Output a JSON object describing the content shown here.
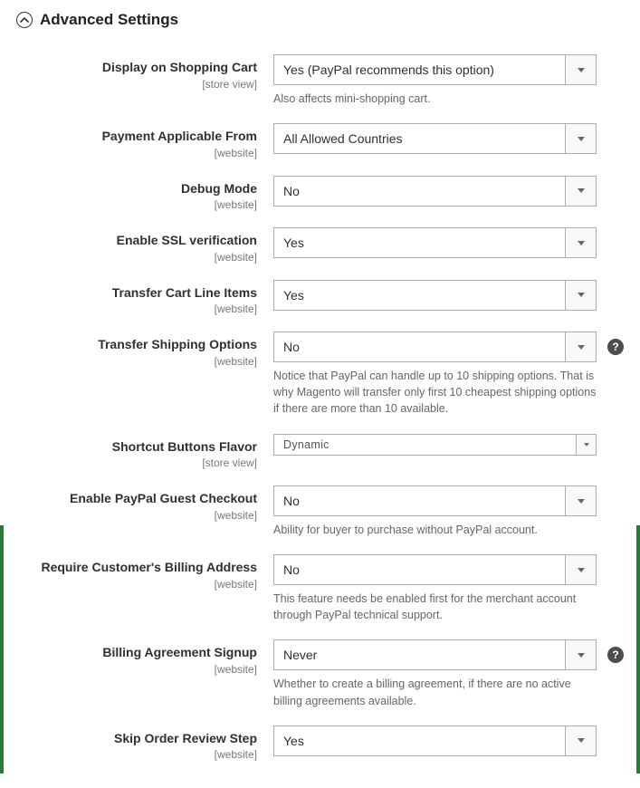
{
  "section": {
    "title": "Advanced Settings"
  },
  "scopes": {
    "store_view": "[store view]",
    "website": "[website]"
  },
  "help_glyph": "?",
  "fields": {
    "display_on_cart": {
      "label": "Display on Shopping Cart",
      "scope": "store_view",
      "value": "Yes (PayPal recommends this option)",
      "note": "Also affects mini-shopping cart."
    },
    "payment_applicable_from": {
      "label": "Payment Applicable From",
      "scope": "website",
      "value": "All Allowed Countries"
    },
    "debug_mode": {
      "label": "Debug Mode",
      "scope": "website",
      "value": "No"
    },
    "enable_ssl": {
      "label": "Enable SSL verification",
      "scope": "website",
      "value": "Yes"
    },
    "transfer_cart_line_items": {
      "label": "Transfer Cart Line Items",
      "scope": "website",
      "value": "Yes"
    },
    "transfer_shipping_options": {
      "label": "Transfer Shipping Options",
      "scope": "website",
      "value": "No",
      "note": "Notice that PayPal can handle up to 10 shipping options. That is why Magento will transfer only first 10 cheapest shipping options if there are more than 10 available.",
      "help": true
    },
    "shortcut_buttons_flavor": {
      "label": "Shortcut Buttons Flavor",
      "scope": "store_view",
      "value": "Dynamic"
    },
    "enable_guest_checkout": {
      "label": "Enable PayPal Guest Checkout",
      "scope": "website",
      "value": "No",
      "note": "Ability for buyer to purchase without PayPal account."
    },
    "require_billing_address": {
      "label": "Require Customer's Billing Address",
      "scope": "website",
      "value": "No",
      "note": "This feature needs be enabled first for the merchant account through PayPal technical support."
    },
    "billing_agreement_signup": {
      "label": "Billing Agreement Signup",
      "scope": "website",
      "value": "Never",
      "note": "Whether to create a billing agreement, if there are no active billing agreements available.",
      "help": true
    },
    "skip_order_review": {
      "label": "Skip Order Review Step",
      "scope": "website",
      "value": "Yes"
    }
  }
}
